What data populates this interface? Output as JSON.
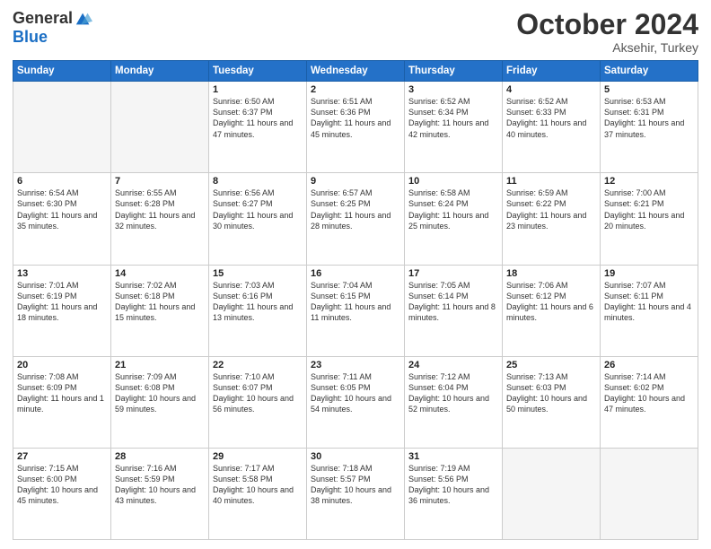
{
  "header": {
    "logo": {
      "general": "General",
      "blue": "Blue"
    },
    "title": "October 2024",
    "location": "Aksehir, Turkey"
  },
  "days_of_week": [
    "Sunday",
    "Monday",
    "Tuesday",
    "Wednesday",
    "Thursday",
    "Friday",
    "Saturday"
  ],
  "weeks": [
    [
      {
        "day": "",
        "detail": ""
      },
      {
        "day": "",
        "detail": ""
      },
      {
        "day": "1",
        "detail": "Sunrise: 6:50 AM\nSunset: 6:37 PM\nDaylight: 11 hours and 47 minutes."
      },
      {
        "day": "2",
        "detail": "Sunrise: 6:51 AM\nSunset: 6:36 PM\nDaylight: 11 hours and 45 minutes."
      },
      {
        "day": "3",
        "detail": "Sunrise: 6:52 AM\nSunset: 6:34 PM\nDaylight: 11 hours and 42 minutes."
      },
      {
        "day": "4",
        "detail": "Sunrise: 6:52 AM\nSunset: 6:33 PM\nDaylight: 11 hours and 40 minutes."
      },
      {
        "day": "5",
        "detail": "Sunrise: 6:53 AM\nSunset: 6:31 PM\nDaylight: 11 hours and 37 minutes."
      }
    ],
    [
      {
        "day": "6",
        "detail": "Sunrise: 6:54 AM\nSunset: 6:30 PM\nDaylight: 11 hours and 35 minutes."
      },
      {
        "day": "7",
        "detail": "Sunrise: 6:55 AM\nSunset: 6:28 PM\nDaylight: 11 hours and 32 minutes."
      },
      {
        "day": "8",
        "detail": "Sunrise: 6:56 AM\nSunset: 6:27 PM\nDaylight: 11 hours and 30 minutes."
      },
      {
        "day": "9",
        "detail": "Sunrise: 6:57 AM\nSunset: 6:25 PM\nDaylight: 11 hours and 28 minutes."
      },
      {
        "day": "10",
        "detail": "Sunrise: 6:58 AM\nSunset: 6:24 PM\nDaylight: 11 hours and 25 minutes."
      },
      {
        "day": "11",
        "detail": "Sunrise: 6:59 AM\nSunset: 6:22 PM\nDaylight: 11 hours and 23 minutes."
      },
      {
        "day": "12",
        "detail": "Sunrise: 7:00 AM\nSunset: 6:21 PM\nDaylight: 11 hours and 20 minutes."
      }
    ],
    [
      {
        "day": "13",
        "detail": "Sunrise: 7:01 AM\nSunset: 6:19 PM\nDaylight: 11 hours and 18 minutes."
      },
      {
        "day": "14",
        "detail": "Sunrise: 7:02 AM\nSunset: 6:18 PM\nDaylight: 11 hours and 15 minutes."
      },
      {
        "day": "15",
        "detail": "Sunrise: 7:03 AM\nSunset: 6:16 PM\nDaylight: 11 hours and 13 minutes."
      },
      {
        "day": "16",
        "detail": "Sunrise: 7:04 AM\nSunset: 6:15 PM\nDaylight: 11 hours and 11 minutes."
      },
      {
        "day": "17",
        "detail": "Sunrise: 7:05 AM\nSunset: 6:14 PM\nDaylight: 11 hours and 8 minutes."
      },
      {
        "day": "18",
        "detail": "Sunrise: 7:06 AM\nSunset: 6:12 PM\nDaylight: 11 hours and 6 minutes."
      },
      {
        "day": "19",
        "detail": "Sunrise: 7:07 AM\nSunset: 6:11 PM\nDaylight: 11 hours and 4 minutes."
      }
    ],
    [
      {
        "day": "20",
        "detail": "Sunrise: 7:08 AM\nSunset: 6:09 PM\nDaylight: 11 hours and 1 minute."
      },
      {
        "day": "21",
        "detail": "Sunrise: 7:09 AM\nSunset: 6:08 PM\nDaylight: 10 hours and 59 minutes."
      },
      {
        "day": "22",
        "detail": "Sunrise: 7:10 AM\nSunset: 6:07 PM\nDaylight: 10 hours and 56 minutes."
      },
      {
        "day": "23",
        "detail": "Sunrise: 7:11 AM\nSunset: 6:05 PM\nDaylight: 10 hours and 54 minutes."
      },
      {
        "day": "24",
        "detail": "Sunrise: 7:12 AM\nSunset: 6:04 PM\nDaylight: 10 hours and 52 minutes."
      },
      {
        "day": "25",
        "detail": "Sunrise: 7:13 AM\nSunset: 6:03 PM\nDaylight: 10 hours and 50 minutes."
      },
      {
        "day": "26",
        "detail": "Sunrise: 7:14 AM\nSunset: 6:02 PM\nDaylight: 10 hours and 47 minutes."
      }
    ],
    [
      {
        "day": "27",
        "detail": "Sunrise: 7:15 AM\nSunset: 6:00 PM\nDaylight: 10 hours and 45 minutes."
      },
      {
        "day": "28",
        "detail": "Sunrise: 7:16 AM\nSunset: 5:59 PM\nDaylight: 10 hours and 43 minutes."
      },
      {
        "day": "29",
        "detail": "Sunrise: 7:17 AM\nSunset: 5:58 PM\nDaylight: 10 hours and 40 minutes."
      },
      {
        "day": "30",
        "detail": "Sunrise: 7:18 AM\nSunset: 5:57 PM\nDaylight: 10 hours and 38 minutes."
      },
      {
        "day": "31",
        "detail": "Sunrise: 7:19 AM\nSunset: 5:56 PM\nDaylight: 10 hours and 36 minutes."
      },
      {
        "day": "",
        "detail": ""
      },
      {
        "day": "",
        "detail": ""
      }
    ]
  ]
}
